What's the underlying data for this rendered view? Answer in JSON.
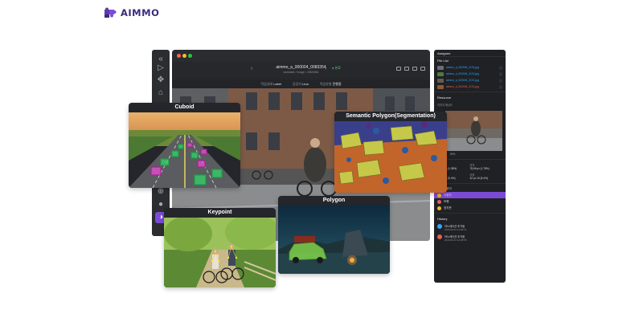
{
  "brand": {
    "name": "AIMMO",
    "accent": "#5b3bb0"
  },
  "editor": {
    "file_name": "aimmo_a_000004_0083354",
    "file_sub": "workable / image / 408/3354",
    "status": "● 완료",
    "meta": [
      {
        "label": "작업상태",
        "value": "Label"
      },
      {
        "label": "담당자",
        "value": "Lina"
      },
      {
        "label": "작업유형",
        "value": "진행중"
      }
    ]
  },
  "tools": [
    "arrow-icon",
    "move-icon",
    "tag-icon",
    "zoom-icon",
    "settings-icon",
    "theme-icon"
  ],
  "right_panel": {
    "header": "Assignee",
    "file_list_title": "File List",
    "files": [
      {
        "name": "aimmo_a_000004_2131.jpg",
        "status": "blue"
      },
      {
        "name": "aimmo_a_000004_2121.jpg",
        "status": "blue"
      },
      {
        "name": "aimmo_a_000004_2121.jpg",
        "status": "blue"
      },
      {
        "name": "aimmo_a_000004_2131.jpg",
        "status": "red"
      }
    ],
    "resource_title": "Resource",
    "resource_label": "이미지 해상도",
    "percent": "80%",
    "stats": [
      {
        "k": "크기",
        "v": "1,944 px (1.38%)"
      },
      {
        "k": "영역",
        "v": "78,66 px (1.78%)"
      },
      {
        "k": "이미지",
        "v": "32 px 16 (5.4%)"
      },
      {
        "k": "비율",
        "v": "32 px 16 (5.4%)"
      }
    ],
    "classes": [
      {
        "label": "고양이",
        "color": "#2fa6ff"
      },
      {
        "label": "자동차",
        "color": "#f0b429"
      },
      {
        "label": "보행",
        "color": "#e25f55"
      },
      {
        "label": "표지판",
        "color": "#f0b429"
      }
    ],
    "history_title": "History",
    "history": [
      {
        "title": "어노테이션 추가됨",
        "time": "2020.06.01 12:09:47",
        "color": "#2fa6ff"
      },
      {
        "title": "어노테이션 추가됨",
        "time": "2020.06.01 12:08:55",
        "color": "#e25f55"
      }
    ]
  },
  "cards": {
    "cuboid": "Cuboid",
    "semantic": "Semantic Polygon(Segmentation)",
    "keypoint": "Keypoint",
    "polygon": "Polygon"
  },
  "colors": {
    "panel": "#1f2124",
    "accent": "#7b4bd6"
  }
}
